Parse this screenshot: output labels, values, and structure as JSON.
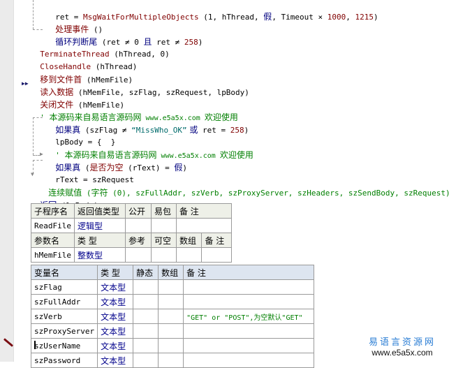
{
  "code": {
    "l1": {
      "a": "ret = ",
      "b": "MsgWaitForMultipleObjects",
      "c": " (1, hThread, ",
      "d": "假",
      "e": ", Timeout × ",
      "f": "1000",
      "g": ", ",
      "h": "1215",
      "i": ")"
    },
    "l2": {
      "a": "处理事件",
      "b": " ()"
    },
    "l3": {
      "a": "循环判断尾",
      "b": " (ret ≠ 0 ",
      "c": "且",
      "d": " ret ≠ ",
      "e": "258",
      "f": ")"
    },
    "l4": {
      "a": "TerminateThread",
      "b": " (hThread, 0)"
    },
    "l5": {
      "a": "CloseHandle",
      "b": " (hThread)"
    },
    "l6": {
      "a": "移到文件首",
      "b": " (hMemFile)"
    },
    "l7": {
      "a": "读入数据",
      "b": " (hMemFile, szFlag, szRequest, lpBody)"
    },
    "l8": {
      "a": "关闭文件",
      "b": " (hMemFile)"
    },
    "l9": {
      "a": "' ",
      "b": "本源码来自易语言源码网",
      "c": " www.e5a5x.com ",
      "d": "欢迎使用"
    },
    "l10": {
      "a": "如果真",
      "b": " (szFlag ≠ ",
      "c": "“MissWho_OK”",
      "d": " 或",
      "e": " ret = ",
      "f": "258",
      "g": ")"
    },
    "l11": {
      "a": "lpBody = {  }"
    },
    "l12": {
      "a": "' ",
      "b": "本源码来自易语言源码网",
      "c": " www.e5a5x.com ",
      "d": "欢迎使用"
    },
    "l13": {
      "a": "如果真",
      "b": " (",
      "c": "是否为空",
      "d": " (rText) = ",
      "e": "假",
      "f": ")"
    },
    "l14": {
      "a": "rText = szRequest"
    },
    "l15": {
      "a": "连续赋值",
      "b": " (",
      "c": "字符",
      "d": " (0), szFullAddr, szVerb, szProxyServer, szHeaders, szSendBody, szRequest)"
    },
    "l16": {
      "a": "返回",
      "b": " (lpBody)"
    }
  },
  "sub_table": {
    "headers": [
      "子程序名",
      "返回值类型",
      "公开",
      "易包",
      "备 注"
    ],
    "row": {
      "name": "ReadFile",
      "type": "逻辑型",
      "public": "",
      "pkg": "",
      "note": ""
    },
    "param_headers": [
      "参数名",
      "类 型",
      "参考",
      "可空",
      "数组",
      "备 注"
    ],
    "params": [
      {
        "name": "hMemFile",
        "type": "整数型",
        "ref": "",
        "nullable": "",
        "array": "",
        "note": ""
      }
    ]
  },
  "var_table": {
    "headers": [
      "变量名",
      "类 型",
      "静态",
      "数组",
      "备 注"
    ],
    "rows": [
      {
        "name": "szFlag",
        "type": "文本型",
        "static": "",
        "array": "",
        "note": ""
      },
      {
        "name": "szFullAddr",
        "type": "文本型",
        "static": "",
        "array": "",
        "note": ""
      },
      {
        "name": "szVerb",
        "type": "文本型",
        "static": "",
        "array": "",
        "note": "\"GET\" or \"POST\",为空默认\"GET\""
      },
      {
        "name": "szProxyServer",
        "type": "文本型",
        "static": "",
        "array": "",
        "note": ""
      },
      {
        "name": "szUserName",
        "type": "文本型",
        "static": "",
        "array": "",
        "note": ""
      },
      {
        "name": "szPassword",
        "type": "文本型",
        "static": "",
        "array": "",
        "note": ""
      }
    ]
  },
  "watermark": {
    "line1": "易语言资源网",
    "line2": "www.e5a5x.com"
  }
}
